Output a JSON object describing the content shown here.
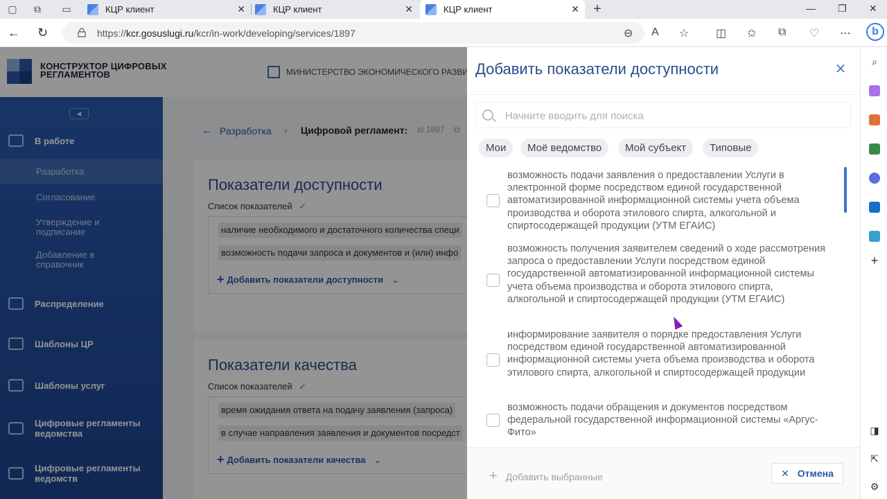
{
  "browser": {
    "tabs": [
      {
        "title": "КЦР клиент"
      },
      {
        "title": "КЦР клиент"
      },
      {
        "title": "КЦР клиент"
      }
    ],
    "url_host": "kcr.gosuslugi.ru",
    "url_path": "/kcr/in-work/developing/services/1897",
    "url_scheme": "https://"
  },
  "header": {
    "logo_line1": "КОНСТРУКТОР ЦИФРОВЫХ",
    "logo_line2": "РЕГЛАМЕНТОВ",
    "ministry": "МИНИСТЕРСТВО ЭКОНОМИЧЕСКОГО РАЗВИТИ"
  },
  "sidebar": {
    "in_work": "В работе",
    "sub_items": [
      {
        "label": "Разработка"
      },
      {
        "label": "Согласование"
      },
      {
        "label": "Утверждение и подписание"
      },
      {
        "label": "Добавление в справочник"
      }
    ],
    "items": [
      {
        "label": "Распределение"
      },
      {
        "label": "Шаблоны ЦР"
      },
      {
        "label": "Шаблоны услуг"
      },
      {
        "label": "Цифровые регламенты ведомства"
      },
      {
        "label": "Цифровые регламенты ведомств"
      }
    ]
  },
  "main": {
    "breadcrumb_back": "Разработка",
    "breadcrumb_current": "Цифровой регламент:",
    "breadcrumb_id": "id 1897",
    "availability": {
      "title": "Показатели доступности",
      "list_label": "Список показателей",
      "rows": [
        "наличие необходимого и достаточного количества специ",
        "возможность подачи запроса и документов и (или) инфо"
      ],
      "add_label": "Добавить показатели доступности"
    },
    "quality": {
      "title": "Показатели качества",
      "list_label": "Список показателей",
      "rows": [
        "время ожидания ответа на подачу заявления (запроса)",
        "в случае направления заявления и документов посредст"
      ],
      "add_label": "Добавить показатели качества"
    }
  },
  "drawer": {
    "title": "Добавить показатели доступности",
    "search_placeholder": "Начните вводить для поиска",
    "filters": [
      "Мои",
      "Моё ведомство",
      "Мой субъект",
      "Типовые"
    ],
    "options": [
      "возможность подачи заявления о предоставлении Услуги в электронной форме посредством единой государственной автоматизированной информационной системы учета объема производства и оборота этилового спирта, алкогольной и спиртосодержащей продукции (УТМ ЕГАИС)",
      "возможность получения заявителем сведений о ходе рассмотрения запроса о предоставлении Услуги посредством единой государственной автоматизированной информационной системы учета объема производства и оборота этилового спирта, алкогольной и спиртосодержащей продукции (УТМ ЕГАИС)",
      "информирование заявителя о порядке предоставления Услуги посредством единой государственной автоматизированной информационной системы учета объема производства и оборота этилового спирта, алкогольной и спиртосодержащей продукции",
      "возможность подачи обращения и документов посредством федеральной государственной информационной системы «Аргус-Фито»"
    ],
    "add_selected": "Добавить выбранные",
    "cancel": "Отмена"
  }
}
